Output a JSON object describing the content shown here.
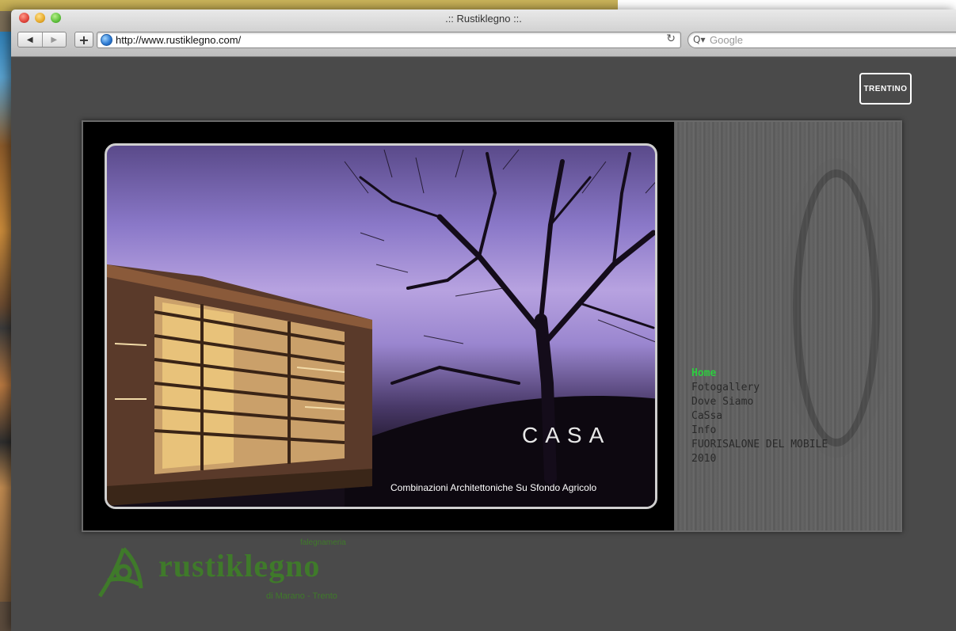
{
  "browser": {
    "window_title": ".:: Rustiklegno ::.",
    "url": "http://www.rustiklegno.com/",
    "search_placeholder": "Google",
    "back_icon": "back-arrow-icon",
    "forward_icon": "forward-arrow-icon",
    "reload_icon": "reload-icon"
  },
  "page": {
    "badge": "TRENTINO",
    "casa_logo": "CASA",
    "casa_subtitle": "Combinazioni Architettoniche Su Sfondo Agricolo",
    "menu": [
      {
        "label": "Home",
        "active": true
      },
      {
        "label": "Fotogallery",
        "active": false
      },
      {
        "label": "Dove Siamo",
        "active": false
      },
      {
        "label": "CaSsa",
        "active": false
      },
      {
        "label": "Info",
        "active": false
      },
      {
        "label": "FUORISALONE DEL MOBILE",
        "active": false
      },
      {
        "label": "2010",
        "active": false
      }
    ],
    "footer_brand": "rustiklegno",
    "footer_top": "falegnameria",
    "footer_bottom": "di Marano - Trento"
  },
  "colors": {
    "menu_active": "#2ecc40",
    "brand_green": "#3f7a2a",
    "page_bg": "#4a4a4a"
  }
}
